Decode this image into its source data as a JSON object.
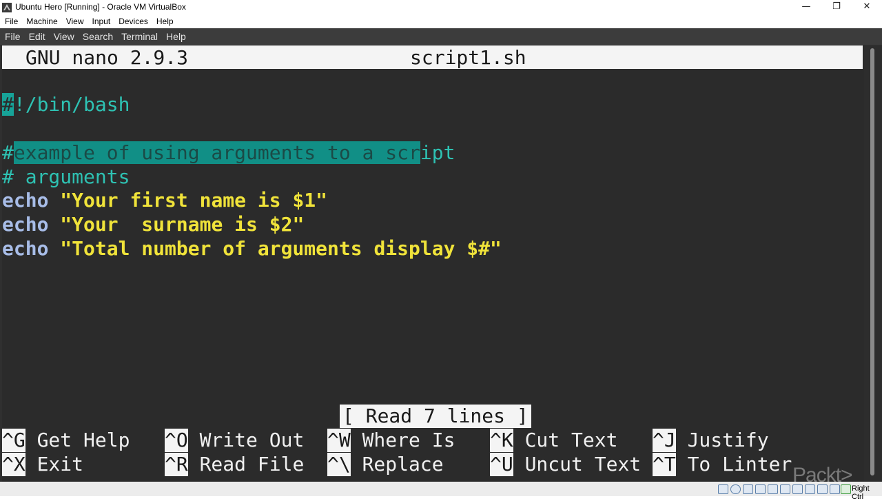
{
  "window": {
    "title": "Ubuntu Hero [Running] - Oracle VM VirtualBox",
    "minimize_glyph": "—",
    "restore_glyph": "❐",
    "close_glyph": "✕"
  },
  "vbox_menu": [
    "File",
    "Machine",
    "View",
    "Input",
    "Devices",
    "Help"
  ],
  "terminal_menu": [
    "File",
    "Edit",
    "View",
    "Search",
    "Terminal",
    "Help"
  ],
  "nano": {
    "version": "GNU nano 2.9.3",
    "filename": "script1.sh",
    "lines": {
      "shebang_hash": "#",
      "shebang_rest": "!/bin/bash",
      "comment1_hash": "#",
      "comment1_selected": "example of using arguments to a scr",
      "comment1_rest": "ipt",
      "comment2": "# arguments",
      "echo1_cmd": "echo",
      "echo1_str": "\"Your first name is $1\"",
      "echo2_cmd": "echo",
      "echo2_str": "\"Your  surname is $2\"",
      "echo3_cmd": "echo",
      "echo3_str": "\"Total number of arguments display $#\""
    },
    "status": "[ Read 7 lines ]",
    "shortcuts": [
      {
        "key": "^G",
        "label": "Get Help"
      },
      {
        "key": "^O",
        "label": "Write Out"
      },
      {
        "key": "^W",
        "label": "Where Is"
      },
      {
        "key": "^K",
        "label": "Cut Text"
      },
      {
        "key": "^J",
        "label": "Justify"
      },
      {
        "key": "^X",
        "label": "Exit"
      },
      {
        "key": "^R",
        "label": "Read File"
      },
      {
        "key": "^\\",
        "label": "Replace"
      },
      {
        "key": "^U",
        "label": "Uncut Text"
      },
      {
        "key": "^T",
        "label": "To Linter"
      }
    ]
  },
  "watermark": "Packt>",
  "host_key": "Right Ctrl",
  "icons": [
    "hdd-icon",
    "optical-icon",
    "audio-icon",
    "network-icon",
    "usb-icon",
    "shared-folder-icon",
    "display-icon",
    "recording-icon",
    "keyboard-icon",
    "mouse-icon",
    "arrow-icon"
  ],
  "colors": {
    "terminal_bg": "#2b2b2b",
    "comment": "#2ec2b3",
    "keyword": "#a8bde8",
    "string": "#f0e33a",
    "selection": "#118f86"
  }
}
